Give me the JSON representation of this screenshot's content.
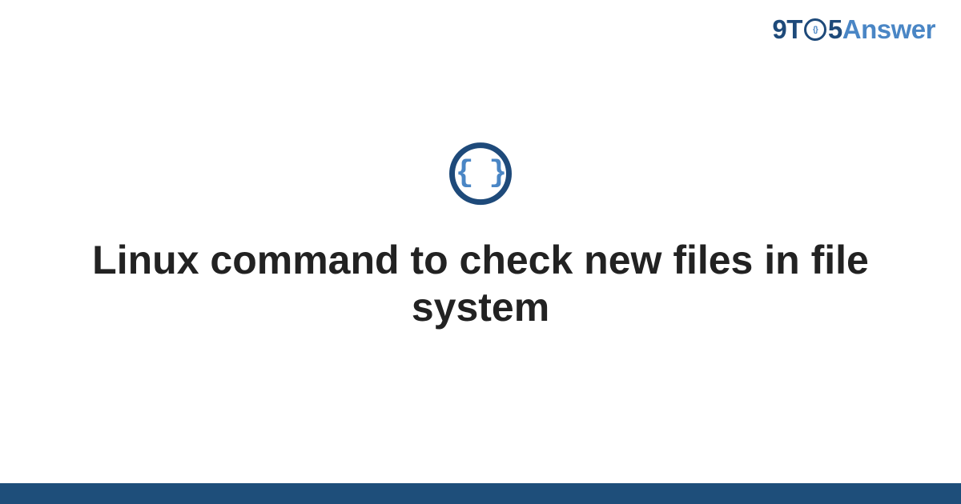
{
  "logo": {
    "part_nine": "9",
    "part_t": "T",
    "part_o_inner": "{}",
    "part_five": "5",
    "part_answer": "Answer"
  },
  "icon": {
    "braces": "{ }"
  },
  "main": {
    "title": "Linux command to check new files in file system"
  },
  "colors": {
    "dark_blue": "#1e4a7a",
    "light_blue": "#4a86c5",
    "bottom_bar": "#1e4e7a",
    "text": "#222222"
  }
}
